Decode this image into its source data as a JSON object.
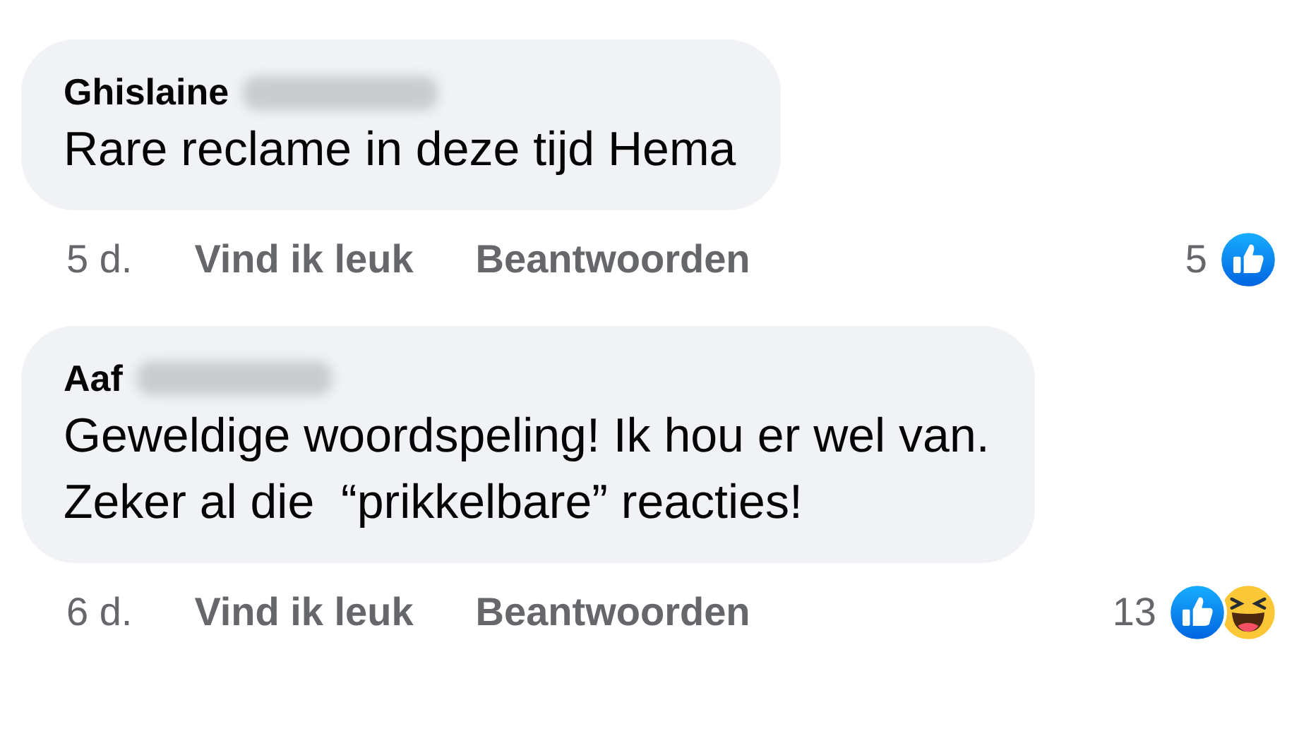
{
  "comments": [
    {
      "author": "Ghislaine",
      "text": "Rare reclame in deze tijd Hema",
      "time": "5 d.",
      "like": "Vind ik leuk",
      "reply": "Beantwoorden",
      "reaction_count": "5",
      "reactions": [
        {
          "kind": "like"
        }
      ]
    },
    {
      "author": "Aaf",
      "text": "Geweldige woordspeling! Ik hou er wel van.\nZeker al die  “prikkelbare” reacties!",
      "time": "6 d.",
      "like": "Vind ik leuk",
      "reply": "Beantwoorden",
      "reaction_count": "13",
      "reactions": [
        {
          "kind": "like"
        },
        {
          "kind": "haha"
        }
      ]
    }
  ]
}
